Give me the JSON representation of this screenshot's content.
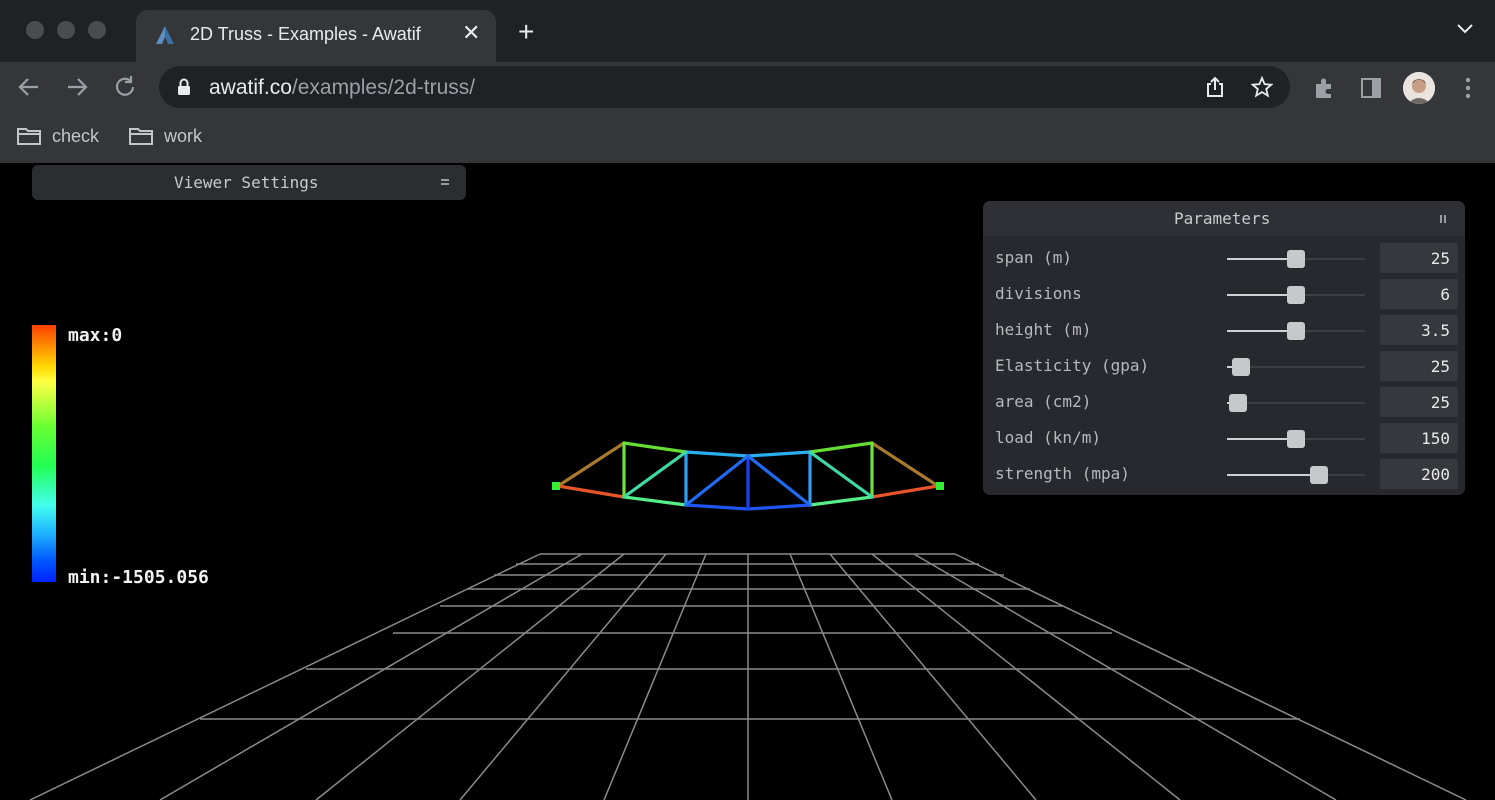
{
  "browser": {
    "tab_title": "2D Truss - Examples - Awatif",
    "url_host": "awatif.co",
    "url_path": "/examples/2d-truss/",
    "bookmarks": [
      {
        "label": "check"
      },
      {
        "label": "work"
      }
    ]
  },
  "viewer_settings": {
    "title": "Viewer Settings"
  },
  "parameters": {
    "title": "Parameters",
    "rows": [
      {
        "label": "span (m)",
        "value": "25",
        "slider_fraction": 0.5
      },
      {
        "label": "divisions",
        "value": "6",
        "slider_fraction": 0.5
      },
      {
        "label": "height (m)",
        "value": "3.5",
        "slider_fraction": 0.5
      },
      {
        "label": "Elasticity (gpa)",
        "value": "25",
        "slider_fraction": 0.1
      },
      {
        "label": "area (cm2)",
        "value": "25",
        "slider_fraction": 0.08
      },
      {
        "label": "load (kn/m)",
        "value": "150",
        "slider_fraction": 0.5
      },
      {
        "label": "strength (mpa)",
        "value": "200",
        "slider_fraction": 0.67
      }
    ]
  },
  "legend": {
    "max_label": "max:0",
    "min_label": "min:-1505.056"
  }
}
